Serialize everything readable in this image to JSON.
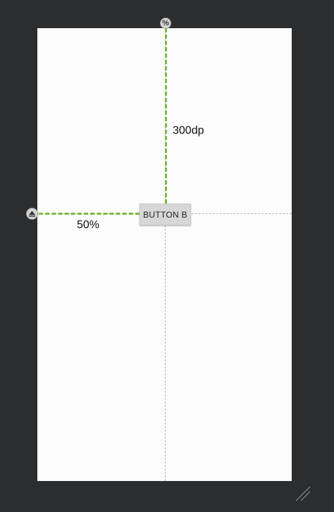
{
  "widget": {
    "label": "BUTTON B"
  },
  "constraints": {
    "top_value": "300dp",
    "left_value": "50%"
  },
  "handles": {
    "percent_symbol": "%",
    "arrow_icon": "triangle-up-icon"
  },
  "colors": {
    "background": "#2c2d2f",
    "canvas": "#fcfcfc",
    "constraint": "#7dbb3f",
    "guideline": "#b5b5b5",
    "button": "#d7d7d7"
  }
}
